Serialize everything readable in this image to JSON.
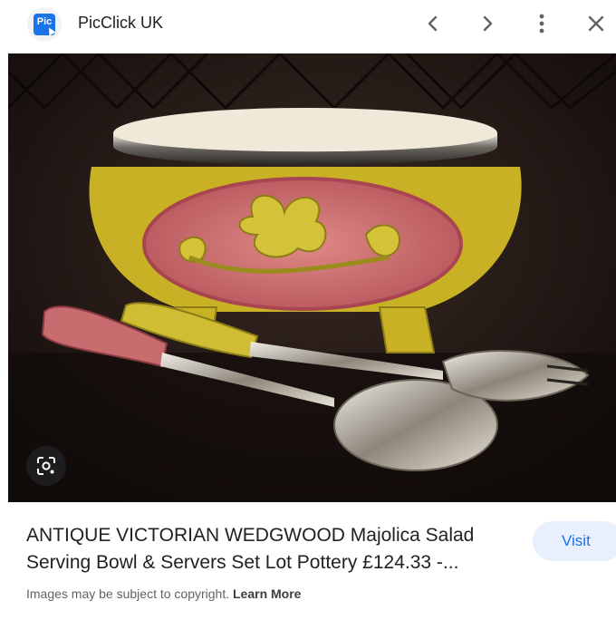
{
  "header": {
    "site_logo_text": "Pic",
    "site_name": "PicClick UK",
    "icons": [
      "chevron-left-icon",
      "chevron-right-icon",
      "more-vert-icon",
      "close-icon"
    ]
  },
  "image": {
    "lens_icon": "google-lens-icon"
  },
  "result": {
    "title": "ANTIQUE VICTORIAN WEDGWOOD Majolica Salad Serving Bowl & Servers Set Lot Pottery £124.33 -...",
    "visit_label": "Visit"
  },
  "footer": {
    "copyright_text": "Images may be subject to copyright.",
    "learn_more_label": "Learn More"
  },
  "colors": {
    "accent": "#1a73e8",
    "visit_bg": "#e8f0fe",
    "text": "#202124",
    "muted": "#5f6368"
  }
}
